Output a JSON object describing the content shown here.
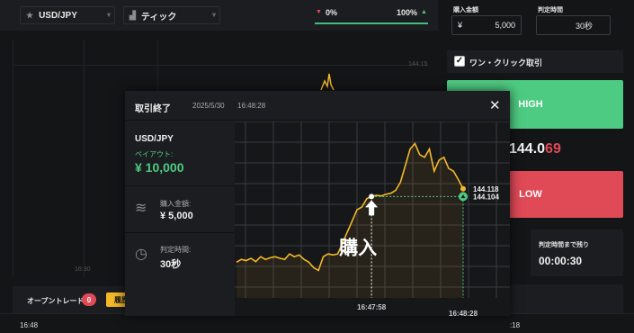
{
  "toolbar": {
    "pair_label": "USD/JPY",
    "chart_type_label": "ティック",
    "left_pct": "0%",
    "right_pct": "100%"
  },
  "background_chart": {
    "price_label": "144.15",
    "time_label": "16:30"
  },
  "right_panel": {
    "amount_label": "購入金額",
    "amount_currency": "¥",
    "amount_value": "5,000",
    "duration_label": "判定時間",
    "duration_value": "30秒",
    "one_click_label": "ワン・クリック取引",
    "one_click_checked": true,
    "high_label": "HIGH",
    "price_main": "144.0",
    "price_tail": "69",
    "low_label": "LOW",
    "countdown_label": "判定時間まで残り",
    "countdown_value": "00:00:30"
  },
  "bottom": {
    "open_trades_label": "オープントレード",
    "open_trades_count": "0",
    "history_button": "履歴",
    "row_time": "16:48",
    "row_time_right": ":18"
  },
  "modal": {
    "title": "取引終了",
    "date": "2025/5/30",
    "time": "16:48:28",
    "pair": "USD/JPY",
    "payout_label": "ペイアウト:",
    "payout_value": "¥ 10,000",
    "amount_label": "購入金額:",
    "amount_value": "¥ 5,000",
    "duration_label": "判定時間:",
    "duration_value": "30秒",
    "icons": [
      "coins-icon",
      "clock-icon",
      "close-icon"
    ]
  },
  "chart_data": {
    "type": "line",
    "title": "",
    "xlabel": "",
    "ylabel": "",
    "x_tick_labels": [
      "16:47:58",
      "16:48:28"
    ],
    "entry_label": "購入",
    "series": [
      {
        "values": [
          143.985,
          143.99,
          143.988,
          143.992,
          143.986,
          143.995,
          143.99,
          143.993,
          143.995,
          143.992,
          143.99,
          144.0,
          143.995,
          143.998,
          143.99,
          143.985,
          143.975,
          143.97,
          143.995,
          144.0,
          143.998,
          144.0,
          144.02,
          144.04,
          144.06,
          144.08,
          144.085,
          144.1,
          144.104,
          144.106,
          144.105,
          144.108,
          144.11,
          144.115,
          144.13,
          144.16,
          144.19,
          144.2,
          144.18,
          144.175,
          144.19,
          144.15,
          144.17,
          144.175,
          144.155,
          144.15,
          144.135,
          144.118
        ]
      }
    ],
    "entry_price": "144.104",
    "close_price": "144.118",
    "colors": {
      "line": "#f2b827",
      "entry": "#4ecb82",
      "grid": "#3a3b3f",
      "high": "#4ecb82",
      "low": "#e04a57"
    }
  }
}
